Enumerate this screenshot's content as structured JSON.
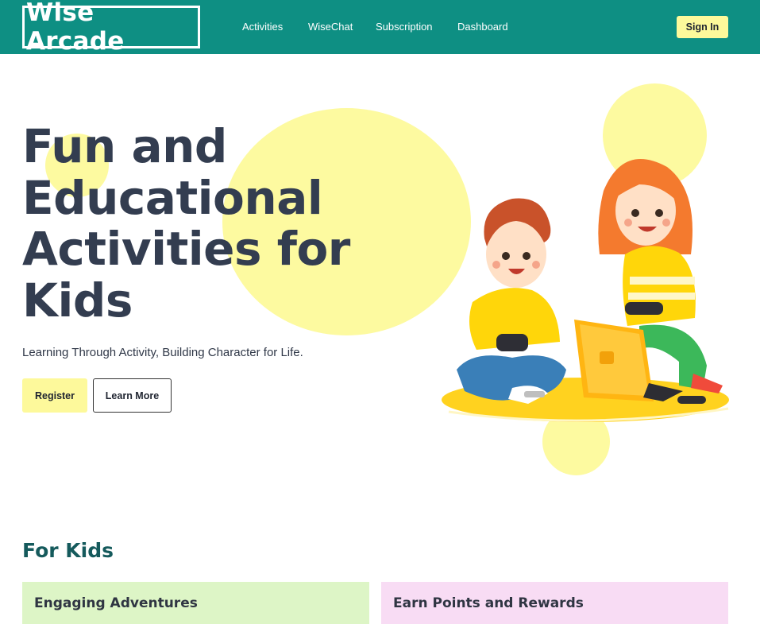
{
  "header": {
    "logo_text": "Wise Arcade",
    "nav": [
      "Activities",
      "WiseChat",
      "Subscription",
      "Dashboard"
    ],
    "signin_label": "Sign In"
  },
  "hero": {
    "title": "Fun and Educational Activities for Kids",
    "subtitle": "Learning Through Activity, Building Character for Life.",
    "register_label": "Register",
    "learn_label": "Learn More",
    "illustration": "kids-gaming-illustration"
  },
  "section": {
    "title": "For Kids",
    "cards": [
      "Engaging Adventures",
      "Earn Points and Rewards"
    ]
  },
  "colors": {
    "brand": "#0e8f83",
    "accent_yellow": "#fdf99b",
    "card_green": "#ddf5c6",
    "card_pink": "#f8dcf4"
  }
}
